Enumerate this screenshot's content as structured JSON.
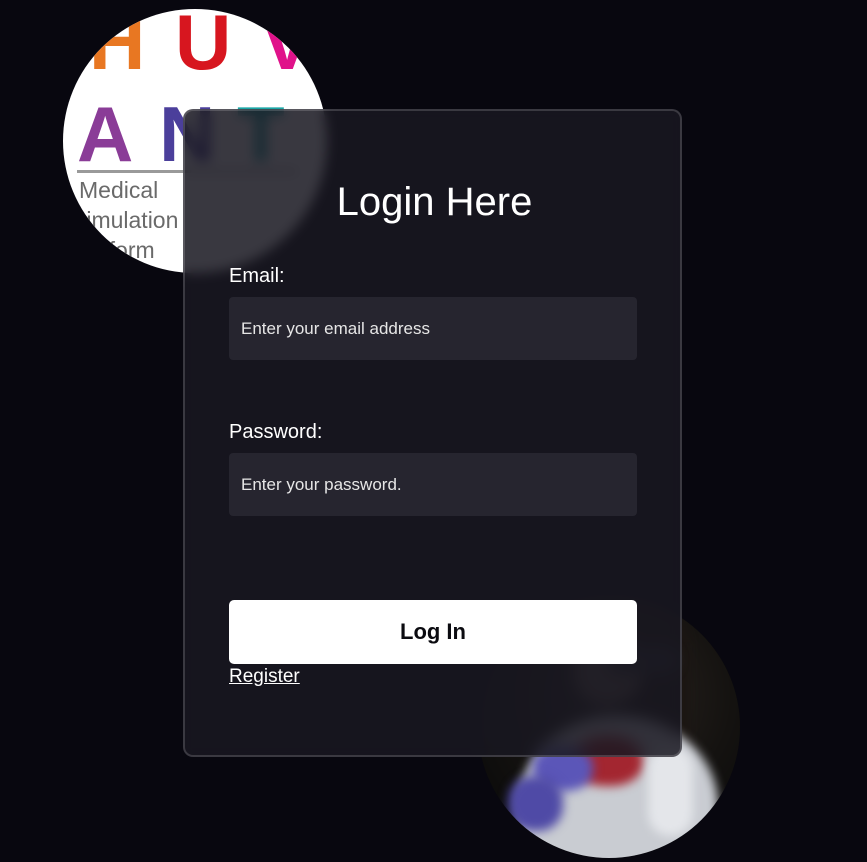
{
  "logo": {
    "row1": [
      {
        "char": "H",
        "color": "#e87722"
      },
      {
        "char": "U",
        "color": "#d7161f"
      },
      {
        "char": "V",
        "color": "#e0128a"
      }
    ],
    "row2": [
      {
        "char": "A",
        "color": "#8a3c97"
      },
      {
        "char": "N",
        "color": "#4b3f9b"
      },
      {
        "char": "T",
        "color": "#1aa6a6"
      }
    ],
    "sub_lines": [
      "Medical",
      "Simulation",
      "Platform"
    ]
  },
  "card": {
    "title": "Login Here",
    "email": {
      "label": "Email:",
      "placeholder": "Enter your email address"
    },
    "password": {
      "label": "Password:",
      "placeholder": "Enter your password."
    },
    "login_label": "Log In",
    "register_label": "Register"
  },
  "colors": {
    "background": "#08070f",
    "card": "#181721",
    "input": "#26252f",
    "button": "#ffffff"
  },
  "icons": {
    "logo": "huvant-logo-icon",
    "photo": "medical-simulation-photo"
  }
}
